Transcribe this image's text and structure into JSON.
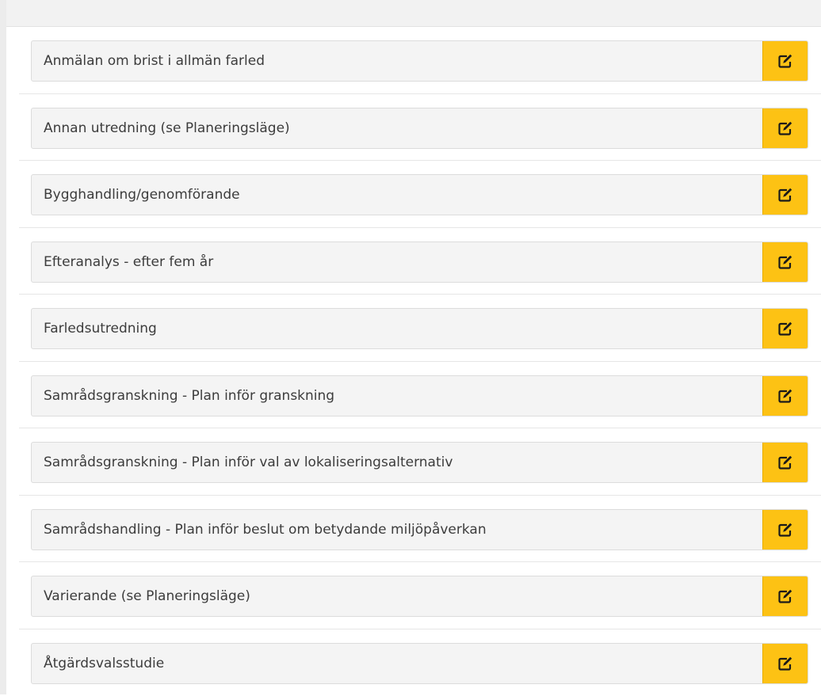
{
  "icons": {
    "edit": "edit-icon"
  },
  "colors": {
    "button": "#fdc214",
    "item_background": "#f4f4f4",
    "text": "#3c3c3c"
  },
  "items": [
    {
      "label": "Anmälan om brist i allmän farled"
    },
    {
      "label": "Annan utredning (se Planeringsläge)"
    },
    {
      "label": "Bygghandling/genomförande"
    },
    {
      "label": "Efteranalys - efter fem år"
    },
    {
      "label": "Farledsutredning"
    },
    {
      "label": "Samrådsgranskning - Plan inför granskning"
    },
    {
      "label": "Samrådsgranskning - Plan inför val av lokaliseringsalternativ"
    },
    {
      "label": "Samrådshandling - Plan inför beslut om betydande miljöpåverkan"
    },
    {
      "label": "Varierande (se Planeringsläge)"
    },
    {
      "label": "Åtgärdsvalsstudie"
    }
  ]
}
